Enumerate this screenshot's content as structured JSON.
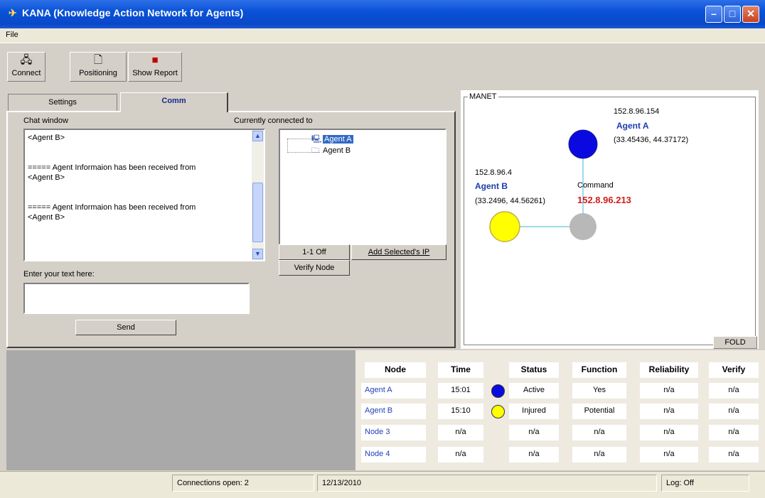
{
  "window": {
    "title": "KANA (Knowledge Action Network for Agents)",
    "icon": "kana-app-icon"
  },
  "menu": {
    "items": [
      "File"
    ]
  },
  "toolbar": {
    "connect": "Connect",
    "positioning": "Positioning",
    "show_report": "Show Report"
  },
  "tabs": {
    "settings": "Settings",
    "comm": "Comm",
    "active": "Comm"
  },
  "comm": {
    "chat_window_label": "Chat window",
    "chat_lines": [
      "<Agent B>",
      "===== Agent Informaion has been received from\n<Agent B>",
      "===== Agent Informaion has been received from\n<Agent B>"
    ],
    "connected_label": "Currently connected to",
    "connected_nodes": [
      {
        "label": "Agent A",
        "selected": true
      },
      {
        "label": "Agent B",
        "selected": false
      }
    ],
    "btn_1to1": "1-1 Off",
    "btn_add_ip": "Add Selected's IP",
    "btn_verify": "Verify Node",
    "enter_text_label": "Enter your text here:",
    "input_value": "",
    "send": "Send"
  },
  "manet": {
    "title": "MANET",
    "agent_a": {
      "ip": "152.8.96.154",
      "name": "Agent A",
      "coords": "(33.45436, 44.37172)",
      "color": "#0a0ae0"
    },
    "agent_b": {
      "ip": "152.8.96.4",
      "name": "Agent B",
      "coords": "(33.2496, 44.56261)",
      "color": "#ffff00"
    },
    "command": {
      "label": "Command",
      "ip": "152.8.96.213",
      "color": "#b8b8b8"
    },
    "fold": "FOLD"
  },
  "table": {
    "headers": [
      "Node",
      "Time",
      "Status",
      "Function",
      "Reliability",
      "Verify"
    ],
    "rows": [
      {
        "node": "Agent A",
        "time": "15:01",
        "dot": "#0a0ae0",
        "status": "Active",
        "function": "Yes",
        "reliability": "n/a",
        "verify": "n/a"
      },
      {
        "node": "Agent B",
        "time": "15:10",
        "dot": "#ffff00",
        "status": "Injured",
        "function": "Potential",
        "reliability": "n/a",
        "verify": "n/a"
      },
      {
        "node": "Node 3",
        "time": "n/a",
        "dot": "",
        "status": "n/a",
        "function": "n/a",
        "reliability": "n/a",
        "verify": "n/a"
      },
      {
        "node": "Node 4",
        "time": "n/a",
        "dot": "",
        "status": "n/a",
        "function": "n/a",
        "reliability": "n/a",
        "verify": "n/a"
      }
    ]
  },
  "statusbar": {
    "connections": "Connections open: 2",
    "date": "12/13/2010",
    "log": "Log: Off"
  }
}
